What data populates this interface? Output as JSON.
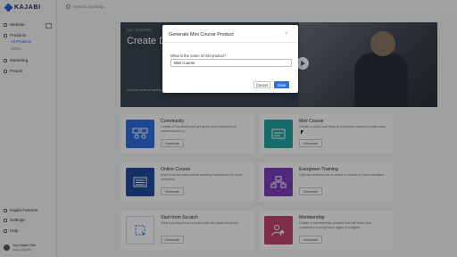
{
  "app": {
    "logo_text": "KAJABI"
  },
  "search": {
    "placeholder": "Search anything..."
  },
  "sidebar": {
    "items": [
      {
        "label": "Website"
      },
      {
        "label": "Products"
      },
      {
        "label": "Marketing"
      },
      {
        "label": "People"
      }
    ],
    "subitems": [
      {
        "label": "All Products"
      },
      {
        "label": "Offers"
      }
    ],
    "bottom_items": [
      {
        "label": "Kajabi Partners"
      },
      {
        "label": "Settings"
      },
      {
        "label": "Help"
      }
    ],
    "user": {
      "name": "Joy Kajabi Site",
      "sub": "Joey Kajabi"
    }
  },
  "hero": {
    "tag": "GET STARTED",
    "title": "Create Digital Products in Minutes.",
    "description": "Choose from a variety of product types below to get started."
  },
  "cards": [
    {
      "title": "Community",
      "description": "Create a Facebook-like group for your members to communicate in.",
      "button": "Generate",
      "color": "#2f6fe0",
      "icon": "community-icon"
    },
    {
      "title": "Mini Course",
      "description": "Create a quick and easy to complete course to build value.",
      "button": "Generate",
      "color": "#23a3a3",
      "icon": "mini-course-icon"
    },
    {
      "title": "Online Course",
      "description": "Build a world-class online learning experience for your members.",
      "button": "Generate",
      "color": "#1f4e9c",
      "icon": "online-course-icon"
    },
    {
      "title": "Evergreen Training",
      "description": "Drip out content over a series of weeks to your members.",
      "button": "Generate",
      "color": "#7b3fbf",
      "icon": "evergreen-icon"
    },
    {
      "title": "Start from Scratch",
      "description": "Start a product from scratch with the blank blueprint.",
      "button": "Generate",
      "color": "#ffffff",
      "icon": "blank-icon"
    },
    {
      "title": "Membership",
      "description": "Create a membership product that will have your customers coming back again and again.",
      "button": "Generate",
      "color": "#c2466e",
      "icon": "membership-icon"
    }
  ],
  "modal": {
    "title": "Generate Mini Course Product",
    "close": "×",
    "label": "What is the name of this product?",
    "input_value": "Mini Course",
    "cancel": "Cancel",
    "save": "Save"
  }
}
